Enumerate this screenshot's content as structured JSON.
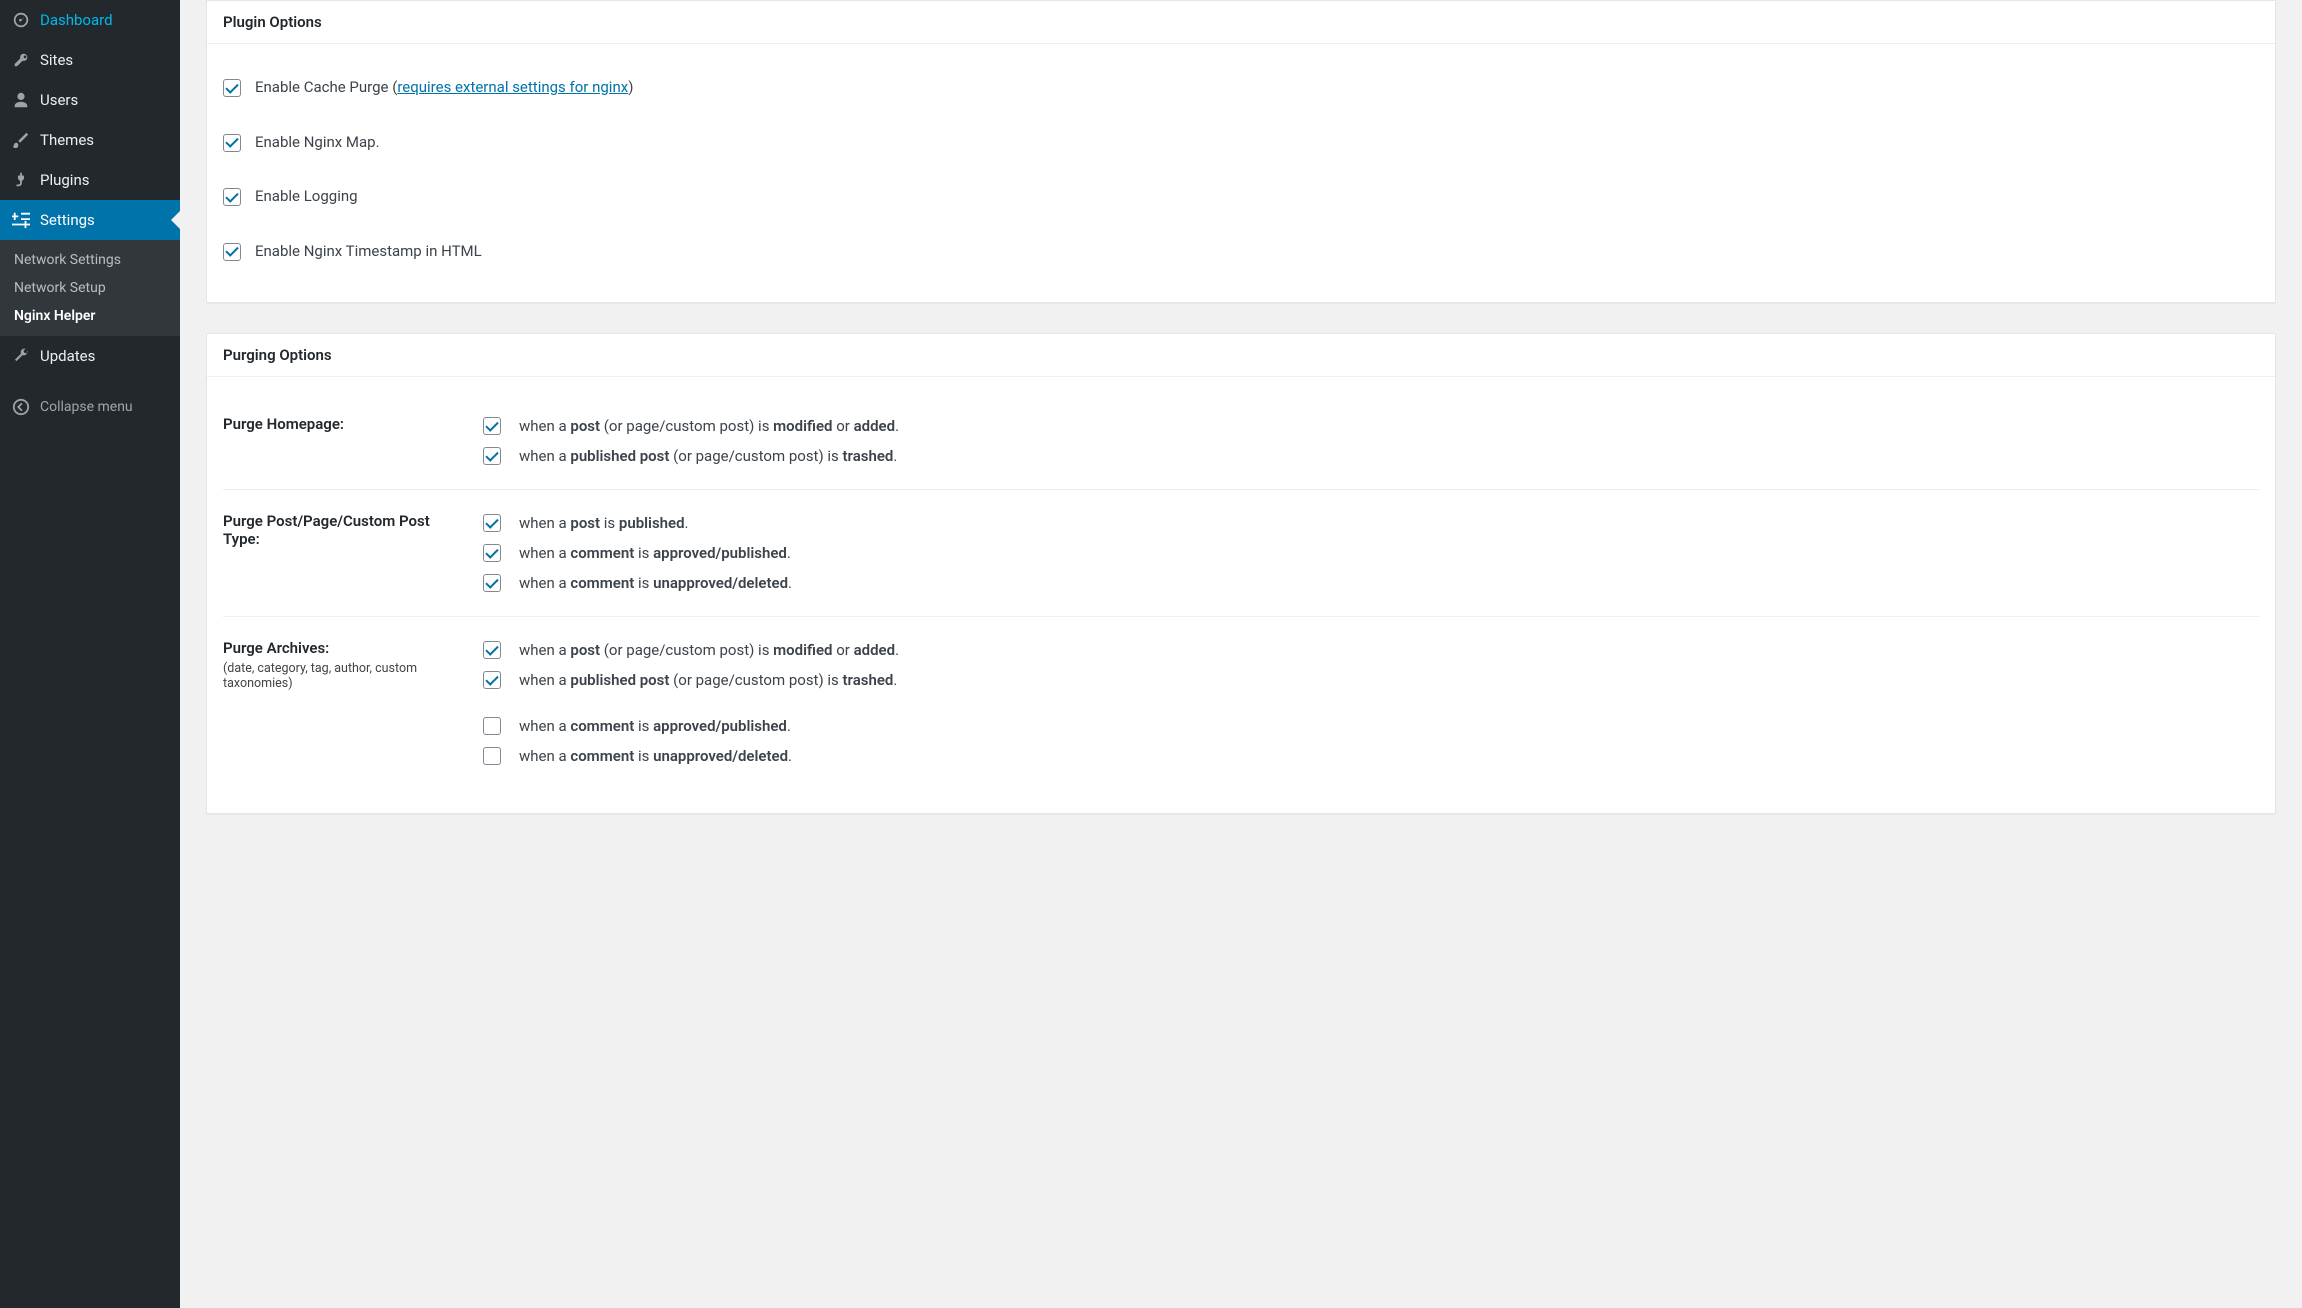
{
  "sidebar": {
    "dashboard": "Dashboard",
    "sites": "Sites",
    "users": "Users",
    "themes": "Themes",
    "plugins": "Plugins",
    "settings": "Settings",
    "settings_sub": {
      "network_settings": "Network Settings",
      "network_setup": "Network Setup",
      "nginx_helper": "Nginx Helper"
    },
    "updates": "Updates",
    "collapse": "Collapse menu"
  },
  "plugin_options": {
    "title": "Plugin Options",
    "enable_cache_purge_pre": "Enable Cache Purge (",
    "enable_cache_purge_link": "requires external settings for nginx",
    "enable_cache_purge_post": ")",
    "enable_nginx_map": "Enable Nginx Map.",
    "enable_logging": "Enable Logging",
    "enable_timestamp": "Enable Nginx Timestamp in HTML"
  },
  "purging": {
    "title": "Purging Options",
    "homepage_label": "Purge Homepage:",
    "post_label": "Purge Post/Page/Custom Post Type:",
    "archives_label": "Purge Archives:",
    "archives_sub": "(date, category, tag, author, custom taxonomies)",
    "txt": {
      "when_a": "when a ",
      "post": "post",
      "published_post": "published post",
      "comment": "comment",
      "or_page_is": " (or page/custom post) is ",
      "is": " is ",
      "modified": "modified",
      "or": " or ",
      "added": "added",
      "trashed": "trashed",
      "published": "published",
      "approved_published": "approved/published",
      "unapproved_deleted": "unapproved/deleted",
      "dot": "."
    }
  }
}
